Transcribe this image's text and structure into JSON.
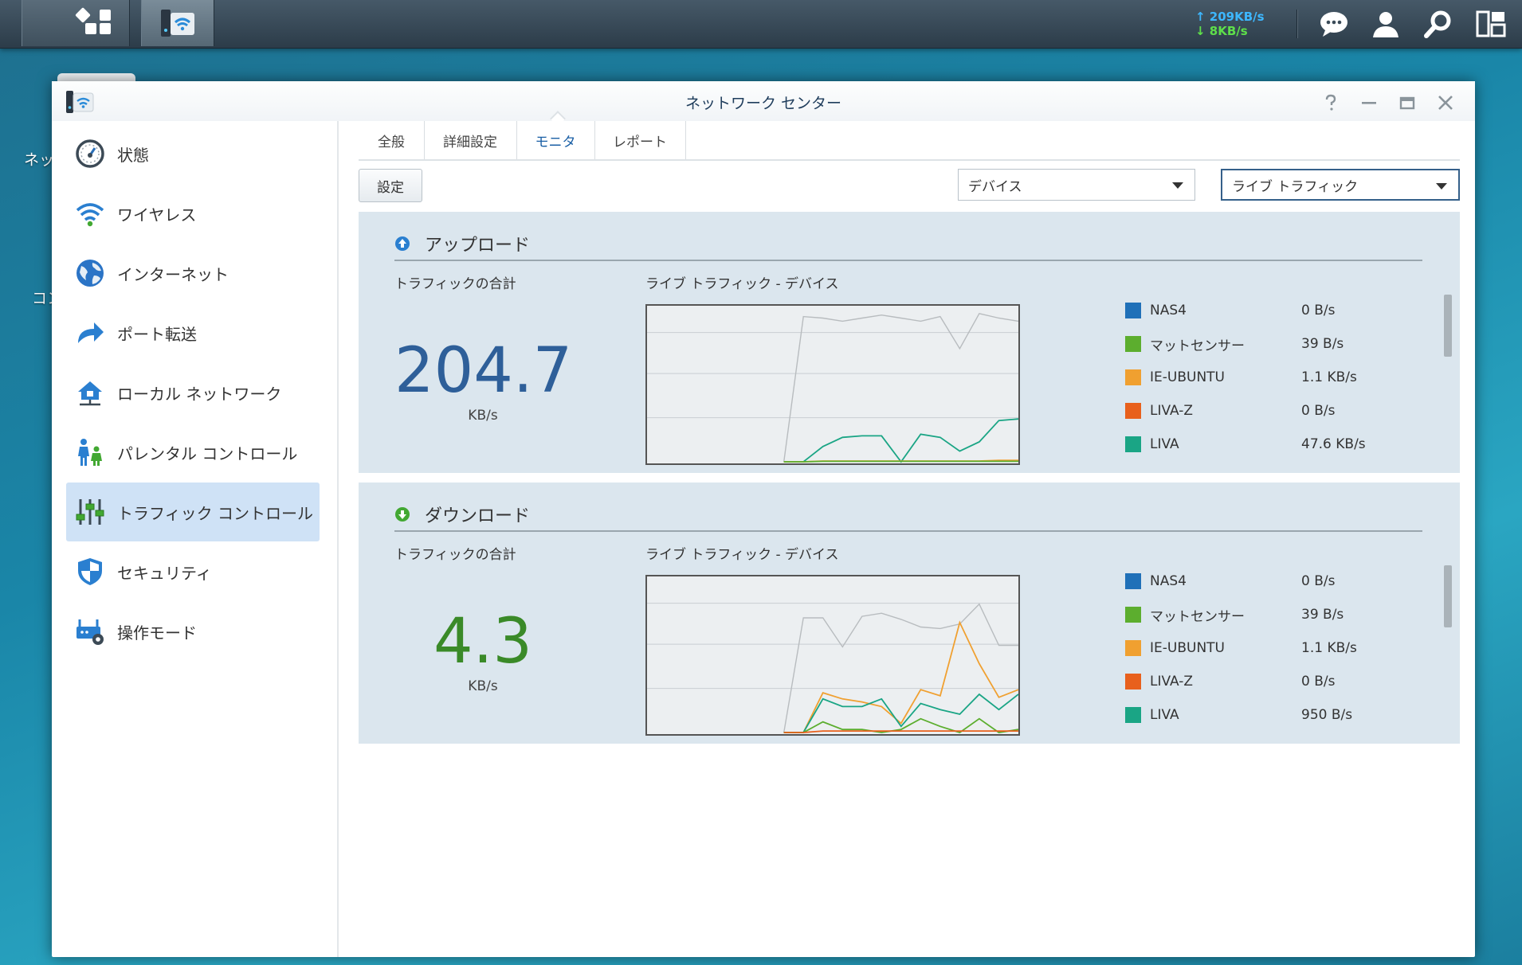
{
  "taskbar": {
    "upload_speed": "↑ 209KB/s",
    "download_speed": "↓ 8KB/s"
  },
  "desktop": {
    "label_1": "ネッ",
    "label_2": "コン"
  },
  "window": {
    "title": "ネットワーク センター",
    "controls": [
      "help-icon",
      "minimize-icon",
      "maximize-icon",
      "close-icon"
    ]
  },
  "sidebar": {
    "items": [
      {
        "label": "状態",
        "icon": "gauge-icon"
      },
      {
        "label": "ワイヤレス",
        "icon": "wifi-icon"
      },
      {
        "label": "インターネット",
        "icon": "globe-icon"
      },
      {
        "label": "ポート転送",
        "icon": "arrow-forward-icon"
      },
      {
        "label": "ローカル ネットワーク",
        "icon": "home-network-icon"
      },
      {
        "label": "パレンタル コントロール",
        "icon": "family-icon"
      },
      {
        "label": "トラフィック コントロール",
        "icon": "sliders-icon"
      },
      {
        "label": "セキュリティ",
        "icon": "shield-icon"
      },
      {
        "label": "操作モード",
        "icon": "router-gear-icon"
      }
    ],
    "selected_index": 6
  },
  "tabs": [
    {
      "label": "全般"
    },
    {
      "label": "詳細設定"
    },
    {
      "label": "モニタ"
    },
    {
      "label": "レポート"
    }
  ],
  "active_tab": "モニタ",
  "toolbar": {
    "settings_label": "設定",
    "device_select": "デバイス",
    "mode_select": "ライブ トラフィック"
  },
  "colors": {
    "upload_number": "#2e5f99",
    "download_number": "#3a8a28",
    "NAS4": "#1f70b8",
    "マットセンサー": "#5cae2e",
    "IE-UBUNTU": "#f0a030",
    "LIVA-Z": "#e8601c",
    "LIVA": "#1aa585",
    "other": "#b8bcbf"
  },
  "upload": {
    "title": "アップロード",
    "total_label": "トラフィックの合計",
    "chart_label": "ライブ トラフィック - デバイス",
    "total_value": "204.7",
    "unit": "KB/s",
    "legend": [
      {
        "name": "NAS4",
        "value": "0 B/s"
      },
      {
        "name": "マットセンサー",
        "value": "39 B/s"
      },
      {
        "name": "IE-UBUNTU",
        "value": "1.1 KB/s"
      },
      {
        "name": "LIVA-Z",
        "value": "0 B/s"
      },
      {
        "name": "LIVA",
        "value": "47.6 KB/s"
      }
    ]
  },
  "download": {
    "title": "ダウンロード",
    "total_label": "トラフィックの合計",
    "chart_label": "ライブ トラフィック - デバイス",
    "total_value": "4.3",
    "unit": "KB/s",
    "legend": [
      {
        "name": "NAS4",
        "value": "0 B/s"
      },
      {
        "name": "マットセンサー",
        "value": "39 B/s"
      },
      {
        "name": "IE-UBUNTU",
        "value": "1.1 KB/s"
      },
      {
        "name": "LIVA-Z",
        "value": "0 B/s"
      },
      {
        "name": "LIVA",
        "value": "950 B/s"
      }
    ]
  },
  "chart_data": [
    {
      "type": "line",
      "title": "ライブ トラフィック - デバイス",
      "ylim": [
        0,
        100
      ],
      "x": [
        0,
        1,
        2,
        3,
        4,
        5,
        6,
        7,
        8,
        9,
        10,
        11,
        12,
        13,
        14,
        15,
        16,
        17,
        18,
        19
      ],
      "series": [
        {
          "name": "",
          "values": [
            0,
            0,
            0,
            0,
            0,
            0,
            0,
            0,
            95,
            94,
            92,
            94,
            96,
            94,
            92,
            95,
            74,
            97,
            94,
            92
          ]
        },
        {
          "name": "LIVA",
          "values": [
            0,
            0,
            0,
            0,
            0,
            0,
            0,
            0,
            0,
            10,
            16,
            17,
            17,
            0,
            18,
            16,
            7,
            13,
            27,
            28
          ]
        },
        {
          "name": "IE-UBUNTU",
          "values": [
            0,
            0,
            0,
            0,
            0,
            0,
            0,
            0,
            0,
            0.5,
            0.5,
            0.5,
            0.5,
            0.5,
            0.5,
            0.5,
            0.5,
            0.5,
            1,
            1
          ]
        },
        {
          "name": "マットセンサー",
          "values": [
            0,
            0,
            0,
            0,
            0,
            0,
            0,
            0,
            0,
            0.3,
            0.3,
            0.3,
            0.3,
            0.3,
            0.3,
            0.3,
            0.3,
            0.3,
            0.3,
            0.3
          ]
        }
      ]
    },
    {
      "type": "line",
      "title": "ライブ トラフィック - デバイス",
      "ylim": [
        0,
        100
      ],
      "x": [
        0,
        1,
        2,
        3,
        4,
        5,
        6,
        7,
        8,
        9,
        10,
        11,
        12,
        13,
        14,
        15,
        16,
        17,
        18,
        19
      ],
      "series": [
        {
          "name": "",
          "values": [
            0,
            0,
            0,
            0,
            0,
            0,
            0,
            0,
            75,
            75,
            56,
            76,
            78,
            74,
            69,
            68,
            71,
            84,
            57,
            57
          ]
        },
        {
          "name": "IE-UBUNTU",
          "values": [
            0,
            0,
            0,
            0,
            0,
            0,
            0,
            0,
            0,
            26,
            22,
            20,
            17,
            6,
            28,
            24,
            72,
            45,
            23,
            28
          ]
        },
        {
          "name": "LIVA",
          "values": [
            0,
            0,
            0,
            0,
            0,
            0,
            0,
            0,
            0,
            22,
            17,
            17,
            22,
            4,
            19,
            15,
            12,
            25,
            15,
            25
          ]
        },
        {
          "name": "マットセンサー",
          "values": [
            0,
            0,
            0,
            0,
            0,
            0,
            0,
            0,
            0,
            7,
            2,
            2,
            0,
            2,
            9,
            4,
            0,
            9,
            0,
            2
          ]
        },
        {
          "name": "LIVA-Z",
          "values": [
            0,
            0,
            0,
            0,
            0,
            0,
            0,
            0,
            0,
            1,
            1,
            1,
            1,
            1,
            1,
            1,
            1,
            1,
            1,
            1
          ]
        }
      ]
    }
  ]
}
